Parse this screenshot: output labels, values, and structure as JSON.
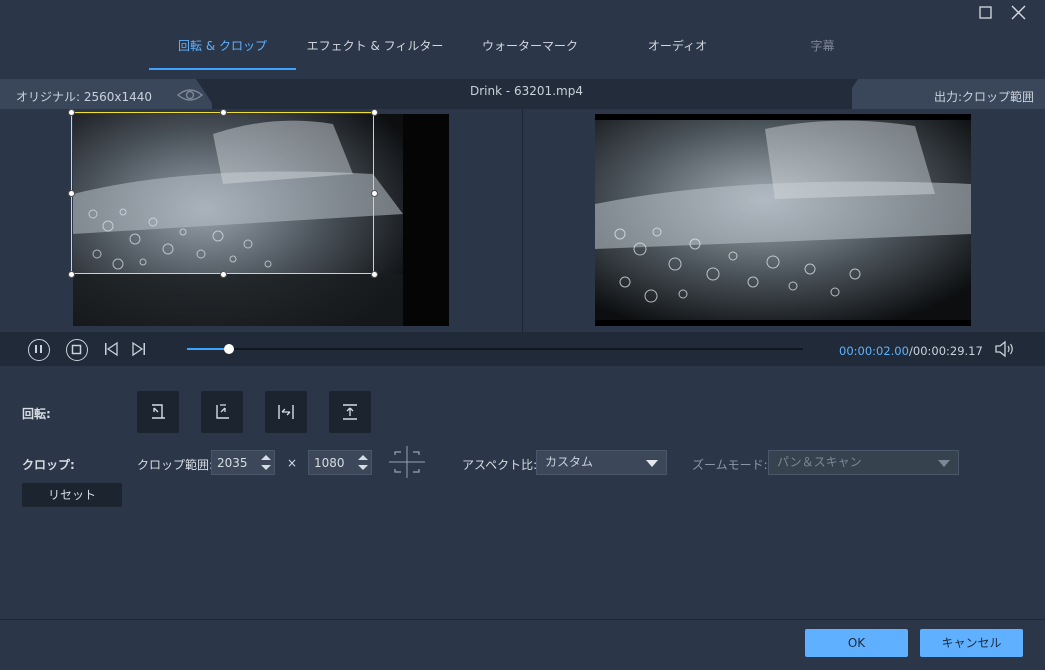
{
  "window": {
    "maximize_icon": "maximize-icon",
    "close_icon": "close-icon"
  },
  "tabs": [
    {
      "label": "回転 & クロップ",
      "state": "active"
    },
    {
      "label": "エフェクト & フィルター",
      "state": "normal"
    },
    {
      "label": "ウォーターマーク",
      "state": "normal"
    },
    {
      "label": "オーディオ",
      "state": "normal"
    },
    {
      "label": "字幕",
      "state": "disabled"
    }
  ],
  "info": {
    "original": "オリジナル: 2560x1440",
    "filename": "Drink - 63201.mp4",
    "output": "出力:クロップ範囲"
  },
  "playback": {
    "current_time": "00:00:02.00",
    "total_time": "/00:00:29.17",
    "progress": 0.068
  },
  "rotate": {
    "label": "回転:"
  },
  "crop": {
    "label": "クロップ:",
    "area_label": "クロップ範囲:",
    "width": "2035",
    "times": "×",
    "height": "1080",
    "reset": "リセット"
  },
  "aspect": {
    "label": "アスペクト比:",
    "value": "カスタム"
  },
  "zoom": {
    "label": "ズームモード:",
    "value": "パン＆スキャン"
  },
  "footer": {
    "ok": "OK",
    "cancel": "キャンセル"
  },
  "colors": {
    "accent": "#3ea2ff",
    "button_primary": "#5fb0ff",
    "crop_border": "#f0e02a"
  }
}
